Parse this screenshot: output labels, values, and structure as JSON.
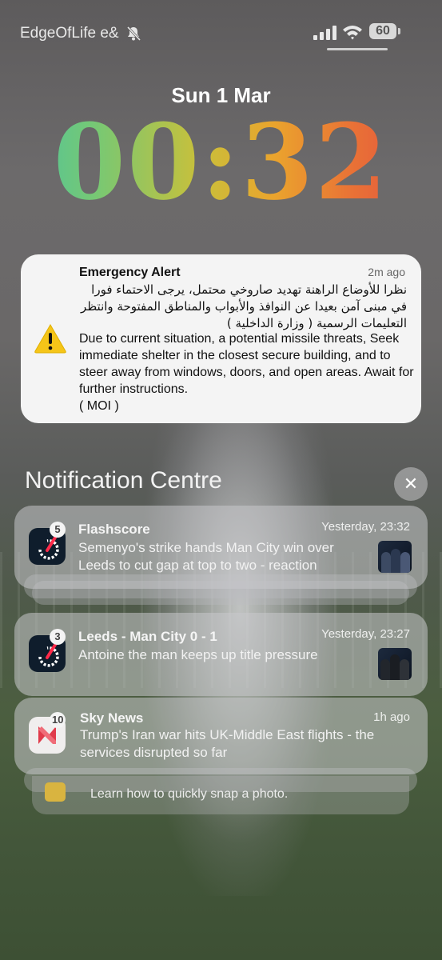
{
  "status_bar": {
    "carrier": "EdgeOfLife e&",
    "battery": "60",
    "icons": [
      "bell-slash-icon",
      "signal-icon",
      "wifi-icon",
      "battery-icon"
    ]
  },
  "lock_screen": {
    "date": "Sun 1 Mar",
    "time": "00:32"
  },
  "emergency_alert": {
    "title": "Emergency Alert",
    "time": "2m ago",
    "arabic_text": "نظرا للأوضاع الراهنة تهديد صاروخي محتمل، يرجى الاحتماء فورا في مبنى آمن بعيدا عن النوافذ والأبواب والمناطق المفتوحة وانتظر التعليمات الرسمية ( وزارة الداخلية )",
    "english_text": "Due to current situation, a potential missile threats, Seek immediate shelter in the closest secure building, and to steer away from windows, doors, and open areas. Await for further instructions.",
    "english_sign": "( MOI )",
    "icon": "warning-triangle-icon"
  },
  "notification_centre": {
    "title": "Notification Centre",
    "close_icon": "close-icon",
    "notifications": [
      {
        "app": "Flashscore",
        "badge": "5",
        "time": "Yesterday, 23:32",
        "body": "Semenyo's strike hands Man City win over Leeds to cut gap at top to two - reaction",
        "icon": "flashscore-icon"
      },
      {
        "app": "Leeds - Man City 0 - 1",
        "badge": "3",
        "time": "Yesterday, 23:27",
        "body": "Antoine the man keeps up title pressure",
        "icon": "flashscore-icon"
      },
      {
        "app": "Sky News",
        "badge": "10",
        "time": "1h ago",
        "body": "Trump's Iran war hits UK-Middle East flights - the services disrupted so far",
        "icon": "sky-news-icon"
      }
    ],
    "hidden_notification": {
      "body": "Learn how to quickly snap a photo."
    }
  }
}
